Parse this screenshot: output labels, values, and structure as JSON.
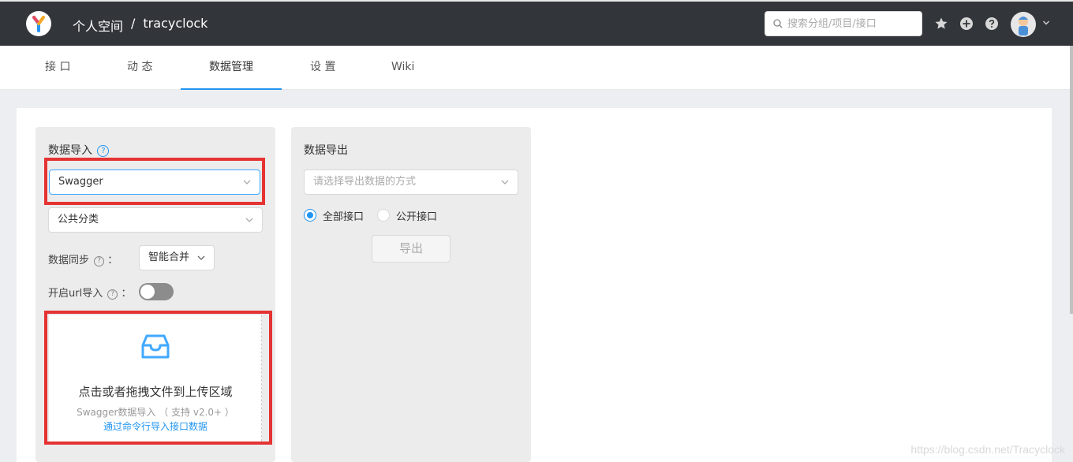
{
  "header": {
    "breadcrumb_space": "个人空间",
    "breadcrumb_sep": "/",
    "breadcrumb_project": "tracyclock",
    "search_placeholder": "搜索分组/项目/接口"
  },
  "tabs": [
    {
      "label": "接 口"
    },
    {
      "label": "动 态"
    },
    {
      "label": "数据管理"
    },
    {
      "label": "设 置"
    },
    {
      "label": "Wiki"
    }
  ],
  "import": {
    "title": "数据导入",
    "type_value": "Swagger",
    "category_value": "公共分类",
    "sync_label": "数据同步",
    "sync_colon": "：",
    "sync_value": "智能合并",
    "url_label": "开启url导入",
    "url_colon": "：",
    "upload_title": "点击或者拖拽文件到上传区域",
    "upload_hint": "Swagger数据导入 （ 支持 v2.0+ ）",
    "upload_link": "通过命令行导入接口数据"
  },
  "export": {
    "title": "数据导出",
    "method_placeholder": "请选择导出数据的方式",
    "radio_all": "全部接口",
    "radio_public": "公开接口",
    "export_button": "导出"
  },
  "watermark": "https://blog.csdn.net/Tracyclock",
  "colors": {
    "header_bg": "#32363a",
    "accent": "#2395f1",
    "highlight": "#e53333"
  }
}
